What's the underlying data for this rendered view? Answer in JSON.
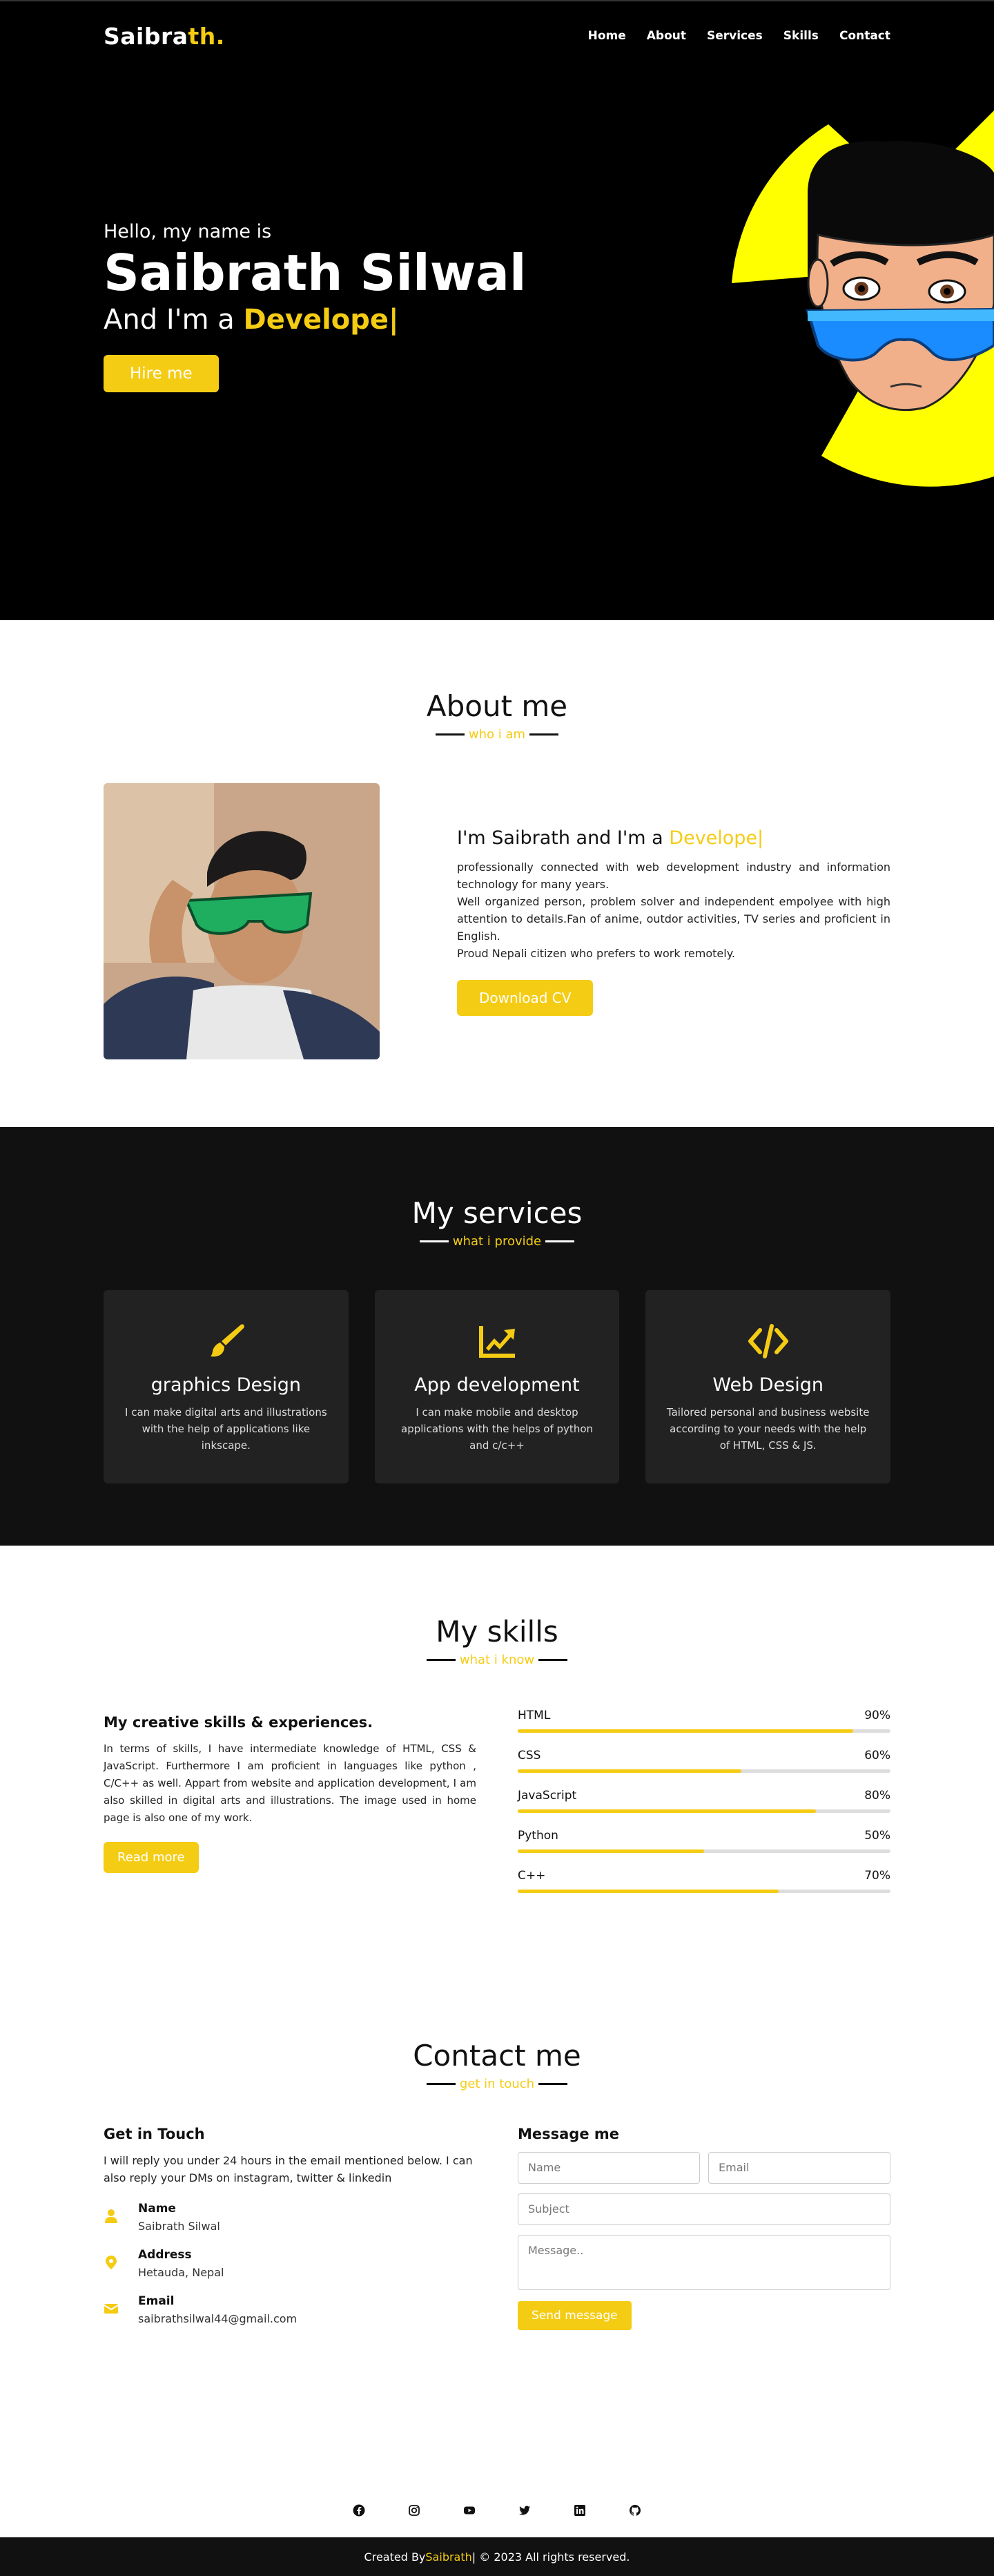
{
  "nav": {
    "logo_main": "Saibra",
    "logo_accent": "th.",
    "items": [
      "Home",
      "About",
      "Services",
      "Skills",
      "Contact"
    ]
  },
  "home": {
    "hello": "Hello, my name is",
    "name": "Saibrath Silwal",
    "role_prefix": "And I'm a ",
    "role_typed": "Develope|",
    "hire_button": "Hire me"
  },
  "about": {
    "title": "About me",
    "subtitle": "who i am",
    "heading_prefix": "I'm Saibrath and I'm a ",
    "heading_typed": "Develope|",
    "paragraph": "professionally connected with web development industry and information technology for many years.",
    "paragraph2": "Well organized person, problem solver and independent empolyee with high attention to details.Fan of anime, outdor activities, TV series and proficient in English.",
    "paragraph3": "Proud Nepali citizen who prefers to work remotely.",
    "cv_button": "Download CV"
  },
  "services": {
    "title": "My services",
    "subtitle": "what i provide",
    "cards": [
      {
        "icon": "paint-brush-icon",
        "title": "graphics Design",
        "text": "I can make digital arts and illustrations with the help of applications like inkscape."
      },
      {
        "icon": "chart-line-icon",
        "title": "App development",
        "text": "I can make mobile and desktop applications with the helps of python and c/c++"
      },
      {
        "icon": "code-icon",
        "title": "Web Design",
        "text": "Tailored personal and business website according to your needs with the help of HTML, CSS & JS."
      }
    ]
  },
  "skills": {
    "title": "My skills",
    "subtitle": "what i know",
    "heading": "My creative skills & experiences.",
    "paragraph": "In terms of skills, I have intermediate knowledge of HTML, CSS & JavaScript. Furthermore I am proficient in languages like python , C/C++ as well. Appart from website and application development, I am also skilled in digital arts and illustrations. The image used in home page is also one of my work.",
    "read_button": "Read more",
    "bars": [
      {
        "name": "HTML",
        "percent": "90%",
        "value": 90
      },
      {
        "name": "CSS",
        "percent": "60%",
        "value": 60
      },
      {
        "name": "JavaScript",
        "percent": "80%",
        "value": 80
      },
      {
        "name": "Python",
        "percent": "50%",
        "value": 50
      },
      {
        "name": "C++",
        "percent": "70%",
        "value": 70
      }
    ]
  },
  "contact": {
    "title": "Contact me",
    "subtitle": "get in touch",
    "left_heading": "Get in Touch",
    "left_text": "I will reply you under 24 hours in the email mentioned below. I can also reply your DMs on instagram, twitter & linkedin",
    "info": [
      {
        "icon": "user-icon",
        "head": "Name",
        "sub": "Saibrath Silwal"
      },
      {
        "icon": "map-marker-icon",
        "head": "Address",
        "sub": "Hetauda, Nepal"
      },
      {
        "icon": "envelope-icon",
        "head": "Email",
        "sub": "saibrathsilwal44@gmail.com"
      }
    ],
    "form_heading": "Message me",
    "placeholders": {
      "name": "Name",
      "email": "Email",
      "subject": "Subject",
      "message": "Message.."
    },
    "send_button": "Send message"
  },
  "footer": {
    "social_icons": [
      "facebook-icon",
      "instagram-icon",
      "youtube-icon",
      "twitter-icon",
      "linkedin-icon",
      "github-icon"
    ],
    "created_by": "Created By ",
    "author": "Saibrath",
    "rights": " | © 2023 All rights reserved."
  },
  "colors": {
    "accent": "#f5cc14",
    "dark": "#000000",
    "services_bg": "#111111",
    "card_bg": "#222222"
  }
}
